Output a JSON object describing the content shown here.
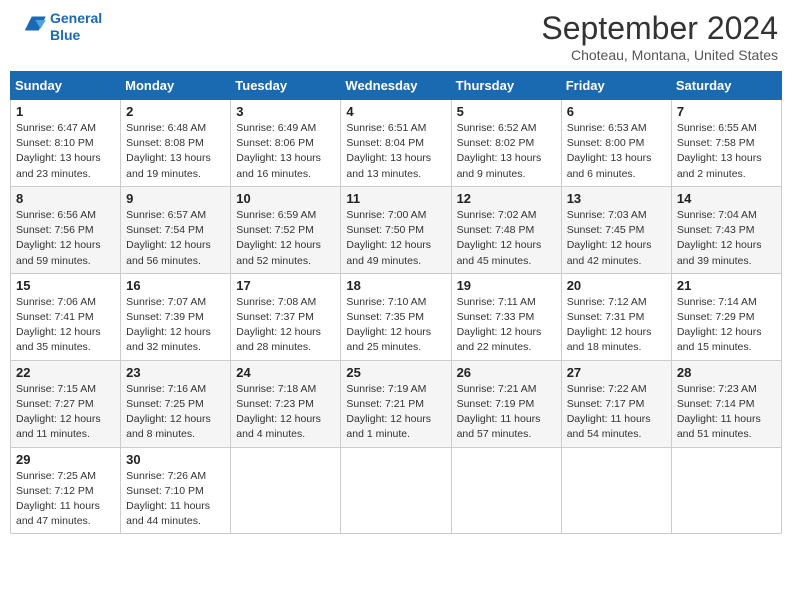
{
  "header": {
    "logo_line1": "General",
    "logo_line2": "Blue",
    "month": "September 2024",
    "location": "Choteau, Montana, United States"
  },
  "days_of_week": [
    "Sunday",
    "Monday",
    "Tuesday",
    "Wednesday",
    "Thursday",
    "Friday",
    "Saturday"
  ],
  "weeks": [
    [
      {
        "day": "1",
        "sunrise": "6:47 AM",
        "sunset": "8:10 PM",
        "daylight": "13 hours and 23 minutes."
      },
      {
        "day": "2",
        "sunrise": "6:48 AM",
        "sunset": "8:08 PM",
        "daylight": "13 hours and 19 minutes."
      },
      {
        "day": "3",
        "sunrise": "6:49 AM",
        "sunset": "8:06 PM",
        "daylight": "13 hours and 16 minutes."
      },
      {
        "day": "4",
        "sunrise": "6:51 AM",
        "sunset": "8:04 PM",
        "daylight": "13 hours and 13 minutes."
      },
      {
        "day": "5",
        "sunrise": "6:52 AM",
        "sunset": "8:02 PM",
        "daylight": "13 hours and 9 minutes."
      },
      {
        "day": "6",
        "sunrise": "6:53 AM",
        "sunset": "8:00 PM",
        "daylight": "13 hours and 6 minutes."
      },
      {
        "day": "7",
        "sunrise": "6:55 AM",
        "sunset": "7:58 PM",
        "daylight": "13 hours and 2 minutes."
      }
    ],
    [
      {
        "day": "8",
        "sunrise": "6:56 AM",
        "sunset": "7:56 PM",
        "daylight": "12 hours and 59 minutes."
      },
      {
        "day": "9",
        "sunrise": "6:57 AM",
        "sunset": "7:54 PM",
        "daylight": "12 hours and 56 minutes."
      },
      {
        "day": "10",
        "sunrise": "6:59 AM",
        "sunset": "7:52 PM",
        "daylight": "12 hours and 52 minutes."
      },
      {
        "day": "11",
        "sunrise": "7:00 AM",
        "sunset": "7:50 PM",
        "daylight": "12 hours and 49 minutes."
      },
      {
        "day": "12",
        "sunrise": "7:02 AM",
        "sunset": "7:48 PM",
        "daylight": "12 hours and 45 minutes."
      },
      {
        "day": "13",
        "sunrise": "7:03 AM",
        "sunset": "7:45 PM",
        "daylight": "12 hours and 42 minutes."
      },
      {
        "day": "14",
        "sunrise": "7:04 AM",
        "sunset": "7:43 PM",
        "daylight": "12 hours and 39 minutes."
      }
    ],
    [
      {
        "day": "15",
        "sunrise": "7:06 AM",
        "sunset": "7:41 PM",
        "daylight": "12 hours and 35 minutes."
      },
      {
        "day": "16",
        "sunrise": "7:07 AM",
        "sunset": "7:39 PM",
        "daylight": "12 hours and 32 minutes."
      },
      {
        "day": "17",
        "sunrise": "7:08 AM",
        "sunset": "7:37 PM",
        "daylight": "12 hours and 28 minutes."
      },
      {
        "day": "18",
        "sunrise": "7:10 AM",
        "sunset": "7:35 PM",
        "daylight": "12 hours and 25 minutes."
      },
      {
        "day": "19",
        "sunrise": "7:11 AM",
        "sunset": "7:33 PM",
        "daylight": "12 hours and 22 minutes."
      },
      {
        "day": "20",
        "sunrise": "7:12 AM",
        "sunset": "7:31 PM",
        "daylight": "12 hours and 18 minutes."
      },
      {
        "day": "21",
        "sunrise": "7:14 AM",
        "sunset": "7:29 PM",
        "daylight": "12 hours and 15 minutes."
      }
    ],
    [
      {
        "day": "22",
        "sunrise": "7:15 AM",
        "sunset": "7:27 PM",
        "daylight": "12 hours and 11 minutes."
      },
      {
        "day": "23",
        "sunrise": "7:16 AM",
        "sunset": "7:25 PM",
        "daylight": "12 hours and 8 minutes."
      },
      {
        "day": "24",
        "sunrise": "7:18 AM",
        "sunset": "7:23 PM",
        "daylight": "12 hours and 4 minutes."
      },
      {
        "day": "25",
        "sunrise": "7:19 AM",
        "sunset": "7:21 PM",
        "daylight": "12 hours and 1 minute."
      },
      {
        "day": "26",
        "sunrise": "7:21 AM",
        "sunset": "7:19 PM",
        "daylight": "11 hours and 57 minutes."
      },
      {
        "day": "27",
        "sunrise": "7:22 AM",
        "sunset": "7:17 PM",
        "daylight": "11 hours and 54 minutes."
      },
      {
        "day": "28",
        "sunrise": "7:23 AM",
        "sunset": "7:14 PM",
        "daylight": "11 hours and 51 minutes."
      }
    ],
    [
      {
        "day": "29",
        "sunrise": "7:25 AM",
        "sunset": "7:12 PM",
        "daylight": "11 hours and 47 minutes."
      },
      {
        "day": "30",
        "sunrise": "7:26 AM",
        "sunset": "7:10 PM",
        "daylight": "11 hours and 44 minutes."
      },
      null,
      null,
      null,
      null,
      null
    ]
  ]
}
